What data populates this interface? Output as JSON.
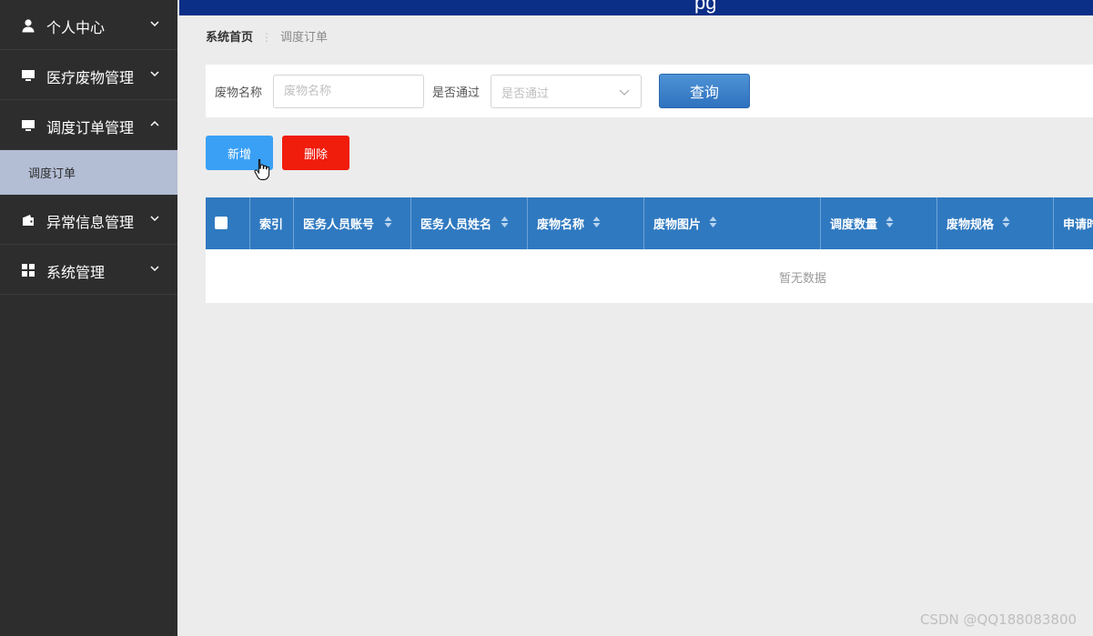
{
  "topbar": {
    "title_fragment": "pg"
  },
  "sidebar": {
    "items": [
      {
        "label": "个人中心",
        "icon": "user-icon",
        "expanded": false
      },
      {
        "label": "医疗废物管理",
        "icon": "monitor-icon",
        "expanded": false
      },
      {
        "label": "调度订单管理",
        "icon": "monitor-icon",
        "expanded": true,
        "children": [
          {
            "label": "调度订单",
            "active": true
          }
        ]
      },
      {
        "label": "异常信息管理",
        "icon": "wallet-icon",
        "expanded": false
      },
      {
        "label": "系统管理",
        "icon": "grid-icon",
        "expanded": false
      }
    ]
  },
  "breadcrumb": {
    "home": "系统首页",
    "current": "调度订单"
  },
  "search": {
    "name_label": "废物名称",
    "name_placeholder": "废物名称",
    "pass_label": "是否通过",
    "pass_placeholder": "是否通过",
    "query_button": "查询"
  },
  "actions": {
    "add": "新增",
    "delete": "删除"
  },
  "table": {
    "columns": [
      "索引",
      "医务人员账号",
      "医务人员姓名",
      "废物名称",
      "废物图片",
      "调度数量",
      "废物规格",
      "申请时间"
    ],
    "empty_text": "暂无数据"
  },
  "colors": {
    "sidebar_bg": "#2d2d2d",
    "topbar_bg": "#0b2e87",
    "header_bg": "#2f79c0",
    "add_button": "#3aa0f5",
    "delete_button": "#f01c0c",
    "active_submenu": "#b3bdd4"
  },
  "watermark": "CSDN @QQ188083800"
}
